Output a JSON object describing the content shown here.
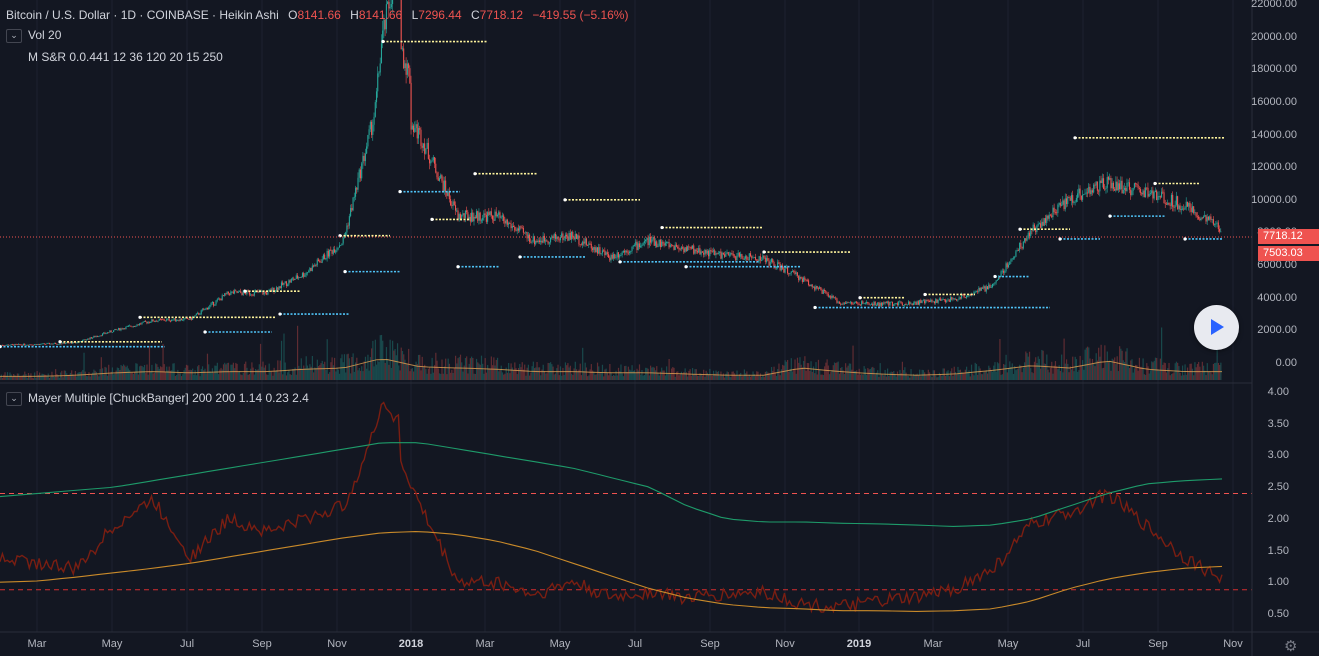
{
  "symbol": {
    "title": "Bitcoin / U.S. Dollar · 1D · COINBASE · Heikin Ashi",
    "open_key": "O",
    "open": "8141.66",
    "high_key": "H",
    "high": "8141.66",
    "low_key": "L",
    "low": "7296.44",
    "close_key": "C",
    "close": "7718.12",
    "change": "−419.55 (−5.16%)"
  },
  "indicators": {
    "vol": "Vol 20",
    "msr": "M S&R 0.0.441 12 36 120 20 15 250",
    "mayer": "Mayer Multiple [ChuckBanger] 200 200 1.14 0.23 2.4"
  },
  "colors": {
    "background": "#131722",
    "up": "#26a69a",
    "down": "#ef5350",
    "support_line": "#4fc3f7",
    "resistance_line": "#fff59d",
    "mayer_line": "#7a1e12",
    "sma_green": "#1e9b6a",
    "sma_orange": "#c98a2a"
  },
  "price_tags": {
    "last": "7718.12",
    "secondary": "7503.03"
  },
  "price_axis": [
    "22000.00",
    "20000.00",
    "18000.00",
    "16000.00",
    "14000.00",
    "12000.00",
    "10000.00",
    "8000.00",
    "6000.00",
    "4000.00",
    "2000.00",
    "0.00"
  ],
  "osc_axis": [
    "4.00",
    "3.50",
    "3.00",
    "2.50",
    "2.00",
    "1.50",
    "1.00",
    "0.50"
  ],
  "time_axis": [
    {
      "label": "Mar",
      "bold": false
    },
    {
      "label": "May",
      "bold": false
    },
    {
      "label": "Jul",
      "bold": false
    },
    {
      "label": "Sep",
      "bold": false
    },
    {
      "label": "Nov",
      "bold": false
    },
    {
      "label": "2018",
      "bold": true
    },
    {
      "label": "Mar",
      "bold": false
    },
    {
      "label": "May",
      "bold": false
    },
    {
      "label": "Jul",
      "bold": false
    },
    {
      "label": "Sep",
      "bold": false
    },
    {
      "label": "Nov",
      "bold": false
    },
    {
      "label": "2019",
      "bold": true
    },
    {
      "label": "Mar",
      "bold": false
    },
    {
      "label": "May",
      "bold": false
    },
    {
      "label": "Jul",
      "bold": false
    },
    {
      "label": "Sep",
      "bold": false
    },
    {
      "label": "Nov",
      "bold": false
    }
  ],
  "chart_data": [
    {
      "type": "line",
      "title": "Bitcoin / U.S. Dollar · 1D · COINBASE · Heikin Ashi",
      "style": "heikin-ashi candles",
      "ylim": [
        0,
        22000
      ],
      "x": [
        "2017-02",
        "2017-03",
        "2017-04",
        "2017-05",
        "2017-06",
        "2017-07",
        "2017-08",
        "2017-09",
        "2017-10",
        "2017-11",
        "2017-12",
        "2018-01",
        "2018-02",
        "2018-03",
        "2018-04",
        "2018-05",
        "2018-06",
        "2018-07",
        "2018-08",
        "2018-09",
        "2018-10",
        "2018-11",
        "2018-12",
        "2019-01",
        "2019-02",
        "2019-03",
        "2019-04",
        "2019-05",
        "2019-06",
        "2019-07",
        "2019-08",
        "2019-09",
        "2019-10"
      ],
      "series": [
        {
          "name": "Close",
          "values": [
            1100,
            1150,
            1250,
            2000,
            2600,
            2700,
            4300,
            4300,
            5500,
            7500,
            17000,
            14000,
            9000,
            9000,
            7500,
            7800,
            6500,
            7500,
            7000,
            6600,
            6400,
            5200,
            3700,
            3600,
            3700,
            3900,
            4700,
            8000,
            10000,
            11000,
            10500,
            9700,
            8200
          ]
        }
      ],
      "last_price": 7718.12
    },
    {
      "type": "area",
      "title": "Vol 20",
      "values_relative": [
        0.15,
        0.15,
        0.2,
        0.3,
        0.35,
        0.3,
        0.35,
        0.35,
        0.45,
        0.5,
        0.9,
        0.55,
        0.5,
        0.45,
        0.35,
        0.35,
        0.3,
        0.3,
        0.25,
        0.2,
        0.2,
        0.5,
        0.35,
        0.25,
        0.2,
        0.25,
        0.4,
        0.6,
        0.5,
        0.8,
        0.45,
        0.35,
        0.35
      ]
    },
    {
      "type": "line",
      "title": "Mayer Multiple [ChuckBanger] 200 200 1.14 0.23 2.4",
      "ylim": [
        0.3,
        4.0
      ],
      "x": [
        "2017-02",
        "2017-03",
        "2017-04",
        "2017-05",
        "2017-06",
        "2017-07",
        "2017-08",
        "2017-09",
        "2017-10",
        "2017-11",
        "2017-12",
        "2018-01",
        "2018-02",
        "2018-03",
        "2018-04",
        "2018-05",
        "2018-06",
        "2018-07",
        "2018-08",
        "2018-09",
        "2018-10",
        "2018-11",
        "2018-12",
        "2019-01",
        "2019-02",
        "2019-03",
        "2019-04",
        "2019-05",
        "2019-06",
        "2019-07",
        "2019-08",
        "2019-09",
        "2019-10"
      ],
      "series": [
        {
          "values": [
            1.4,
            1.3,
            1.2,
            1.9,
            2.3,
            1.4,
            2.0,
            1.8,
            2.0,
            2.2,
            3.6,
            2.2,
            1.0,
            1.0,
            0.8,
            1.0,
            0.75,
            0.85,
            0.75,
            0.8,
            0.85,
            0.65,
            0.6,
            0.7,
            0.75,
            0.9,
            1.2,
            1.9,
            2.1,
            2.4,
            1.9,
            1.4,
            1.05
          ]
        },
        {
          "values": [
            2.35,
            2.4,
            2.45,
            2.5,
            2.6,
            2.7,
            2.8,
            2.9,
            3.0,
            3.1,
            3.2,
            3.2,
            3.1,
            3.0,
            2.9,
            2.8,
            2.65,
            2.5,
            2.2,
            2.0,
            1.95,
            1.95,
            1.93,
            1.92,
            1.9,
            1.88,
            1.9,
            2.0,
            2.2,
            2.4,
            2.55,
            2.6,
            2.63
          ]
        },
        {
          "values": [
            1.0,
            1.02,
            1.08,
            1.15,
            1.22,
            1.3,
            1.4,
            1.5,
            1.6,
            1.7,
            1.78,
            1.8,
            1.75,
            1.65,
            1.5,
            1.3,
            1.1,
            0.9,
            0.75,
            0.65,
            0.6,
            0.58,
            0.55,
            0.55,
            0.54,
            0.55,
            0.58,
            0.7,
            0.9,
            1.05,
            1.15,
            1.22,
            1.25
          ]
        }
      ],
      "hlines": [
        2.4,
        0.88
      ]
    }
  ]
}
